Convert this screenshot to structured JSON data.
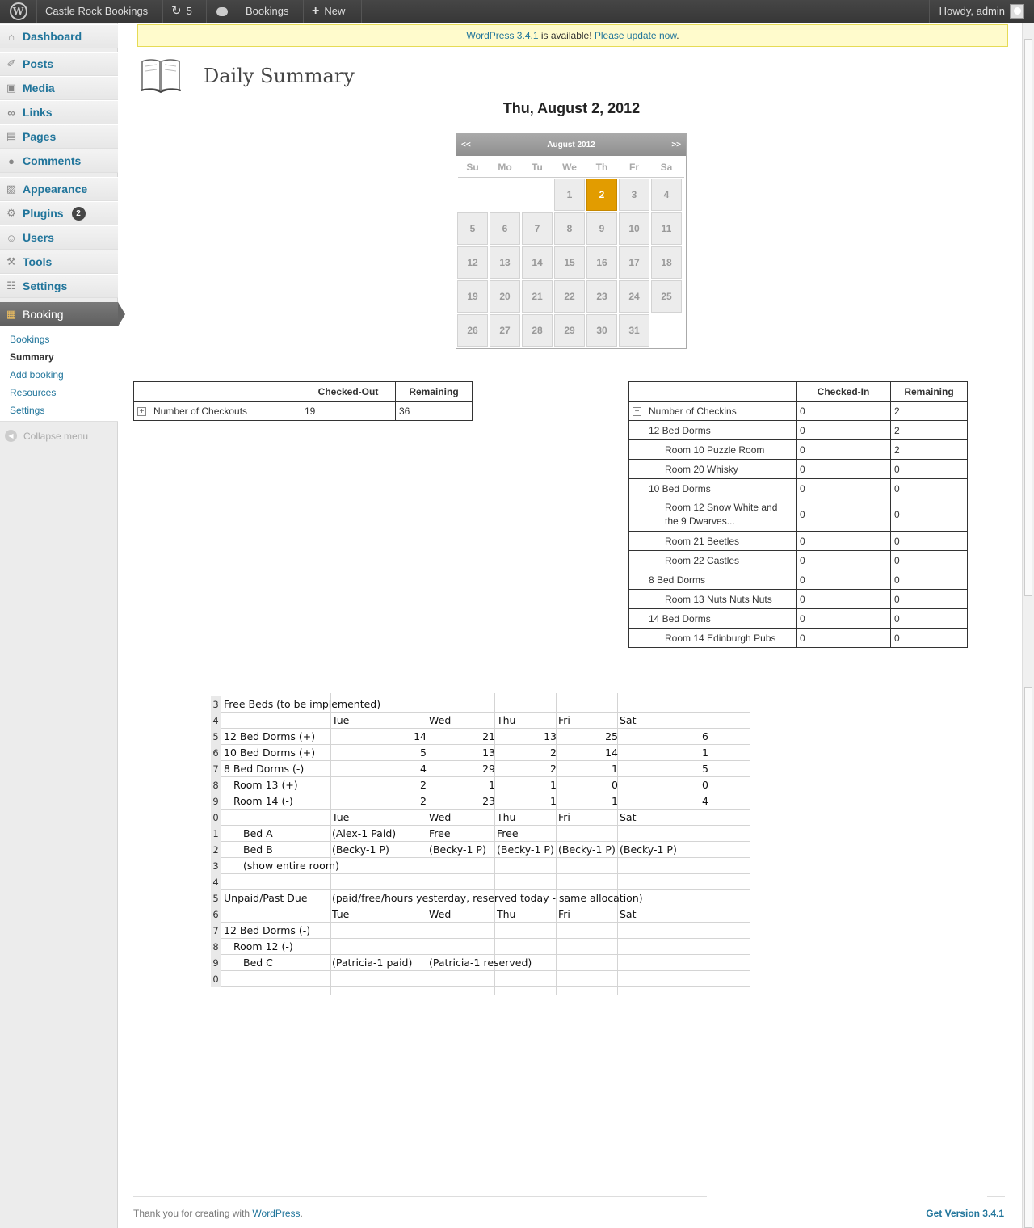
{
  "adminbar": {
    "site_name": "Castle Rock Bookings",
    "updates_count": "5",
    "bookings_label": "Bookings",
    "new_label": "New",
    "howdy": "Howdy, admin"
  },
  "sidebar": {
    "items": [
      {
        "label": "Dashboard"
      },
      {
        "label": "Posts"
      },
      {
        "label": "Media"
      },
      {
        "label": "Links"
      },
      {
        "label": "Pages"
      },
      {
        "label": "Comments"
      },
      {
        "label": "Appearance"
      },
      {
        "label": "Plugins",
        "badge": "2"
      },
      {
        "label": "Users"
      },
      {
        "label": "Tools"
      },
      {
        "label": "Settings"
      },
      {
        "label": "Booking"
      }
    ],
    "submenu": [
      "Bookings",
      "Summary",
      "Add booking",
      "Resources",
      "Settings"
    ],
    "collapse": "Collapse menu"
  },
  "notice": {
    "link1": "WordPress 3.4.1",
    "middle": " is available! ",
    "link2": "Please update now",
    "end": "."
  },
  "page": {
    "title": "Daily Summary",
    "date": "Thu, August 2, 2012"
  },
  "calendar": {
    "prev": "<<",
    "next": ">>",
    "month": "August 2012",
    "dow": [
      "Su",
      "Mo",
      "Tu",
      "We",
      "Th",
      "Fr",
      "Sa"
    ],
    "days": [
      "1",
      "2",
      "3",
      "4",
      "5",
      "6",
      "7",
      "8",
      "9",
      "10",
      "11",
      "12",
      "13",
      "14",
      "15",
      "16",
      "17",
      "18",
      "19",
      "20",
      "21",
      "22",
      "23",
      "24",
      "25",
      "26",
      "27",
      "28",
      "29",
      "30",
      "31"
    ],
    "selected": "2"
  },
  "checkouts": {
    "headers": [
      "",
      "Checked-Out",
      "Remaining"
    ],
    "row": {
      "label": "Number of Checkouts",
      "checked": "19",
      "remaining": "36"
    }
  },
  "checkins": {
    "headers": [
      "",
      "Checked-In",
      "Remaining"
    ],
    "rows": [
      {
        "label": "Number of Checkins",
        "checked": "0",
        "remaining": "2"
      },
      {
        "label": "12 Bed Dorms",
        "checked": "0",
        "remaining": "2"
      },
      {
        "label": "Room 10 Puzzle Room",
        "checked": "0",
        "remaining": "2"
      },
      {
        "label": "Room 20 Whisky",
        "checked": "0",
        "remaining": "0"
      },
      {
        "label": "10 Bed Dorms",
        "checked": "0",
        "remaining": "0"
      },
      {
        "label": "Room 12 Snow White and the 9 Dwarves...",
        "checked": "0",
        "remaining": "0"
      },
      {
        "label": "Room 21 Beetles",
        "checked": "0",
        "remaining": "0"
      },
      {
        "label": "Room 22 Castles",
        "checked": "0",
        "remaining": "0"
      },
      {
        "label": "8 Bed Dorms",
        "checked": "0",
        "remaining": "0"
      },
      {
        "label": "Room 13 Nuts Nuts Nuts",
        "checked": "0",
        "remaining": "0"
      },
      {
        "label": "14 Bed Dorms",
        "checked": "0",
        "remaining": "0"
      },
      {
        "label": "Room 14 Edinburgh Pubs",
        "checked": "0",
        "remaining": "0"
      }
    ]
  },
  "sheet": {
    "rows": [
      {
        "n": "3",
        "a": "Free Beds (to be implemented)",
        "b": "",
        "c": "",
        "d": "",
        "e": "",
        "f": ""
      },
      {
        "n": "4",
        "a": "",
        "b": "Tue",
        "c": "Wed",
        "d": "Thu",
        "e": "Fri",
        "f": "Sat"
      },
      {
        "n": "5",
        "a": "12 Bed Dorms (+)",
        "b": "14",
        "c": "21",
        "d": "13",
        "e": "25",
        "f": "6"
      },
      {
        "n": "6",
        "a": "10 Bed Dorms (+)",
        "b": "5",
        "c": "13",
        "d": "2",
        "e": "14",
        "f": "1"
      },
      {
        "n": "7",
        "a": "8 Bed Dorms (-)",
        "b": "4",
        "c": "29",
        "d": "2",
        "e": "1",
        "f": "5"
      },
      {
        "n": "8",
        "a": "Room 13 (+)",
        "b": "2",
        "c": "1",
        "d": "1",
        "e": "0",
        "f": "0"
      },
      {
        "n": "9",
        "a": "Room 14 (-)",
        "b": "2",
        "c": "23",
        "d": "1",
        "e": "1",
        "f": "4"
      },
      {
        "n": "0",
        "a": "",
        "b": "Tue",
        "c": "Wed",
        "d": "Thu",
        "e": "Fri",
        "f": "Sat"
      },
      {
        "n": "1",
        "a": "Bed A",
        "b": "(Alex-1 Paid)",
        "c": "Free",
        "d": "Free",
        "e": "",
        "f": ""
      },
      {
        "n": "2",
        "a": "Bed B",
        "b": "(Becky-1 P)",
        "c": "(Becky-1 P)",
        "d": "(Becky-1 P)",
        "e": "(Becky-1 P)",
        "f": "(Becky-1 P)"
      },
      {
        "n": "3",
        "a": "(show entire room)",
        "b": "",
        "c": "",
        "d": "",
        "e": "",
        "f": ""
      },
      {
        "n": "4",
        "a": "",
        "b": "",
        "c": "",
        "d": "",
        "e": "",
        "f": ""
      },
      {
        "n": "5",
        "a": "Unpaid/Past Due",
        "b": "(paid/free/hours yesterday, reserved today - same allocation)",
        "c": "",
        "d": "",
        "e": "",
        "f": ""
      },
      {
        "n": "6",
        "a": "",
        "b": "Tue",
        "c": "Wed",
        "d": "Thu",
        "e": "Fri",
        "f": "Sat"
      },
      {
        "n": "7",
        "a": "12 Bed Dorms (-)",
        "b": "",
        "c": "",
        "d": "",
        "e": "",
        "f": ""
      },
      {
        "n": "8",
        "a": "Room 12 (-)",
        "b": "",
        "c": "",
        "d": "",
        "e": "",
        "f": ""
      },
      {
        "n": "9",
        "a": "Bed C",
        "b": "(Patricia-1 paid)",
        "c": "(Patricia-1 reserved)",
        "d": "",
        "e": "",
        "f": ""
      },
      {
        "n": "0",
        "a": "",
        "b": "",
        "c": "",
        "d": "",
        "e": "",
        "f": ""
      }
    ]
  },
  "footer": {
    "text": "Thank you for creating with ",
    "link": "WordPress",
    "end": ".",
    "version": "Get Version 3.4.1"
  }
}
